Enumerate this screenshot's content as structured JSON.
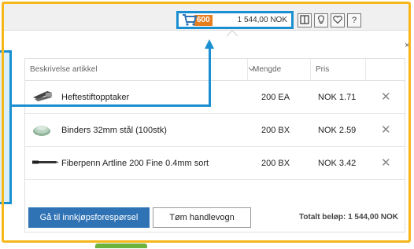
{
  "toolbar": {
    "cart_count": "600",
    "cart_total": "1 544,00 NOK",
    "buttons": [
      "layout-icon",
      "lightbulb-icon",
      "heart-icon",
      "help-icon"
    ],
    "help_label": "?"
  },
  "table": {
    "headers": {
      "description": "Beskrivelse artikkel",
      "quantity": "Mengde",
      "price": "Pris"
    },
    "rows": [
      {
        "description": "Heftestiftopptaker",
        "quantity": "200 EA",
        "price": "NOK 1.71",
        "icon": "staple-remover-icon"
      },
      {
        "description": "Binders 32mm stål (100stk)",
        "quantity": "200 BX",
        "price": "NOK 2.59",
        "icon": "paper-clips-icon"
      },
      {
        "description": "Fiberpenn Artline 200 Fine 0.4mm sort",
        "quantity": "200 BX",
        "price": "NOK 3.42",
        "icon": "pen-icon"
      }
    ],
    "delete_glyph": "✕"
  },
  "footer": {
    "primary_button": "Gå til innkjøpsforespørsel",
    "secondary_button": "Tøm handlevogn",
    "total_label": "Totalt beløp: 1 544,00 NOK"
  },
  "close_glyph": "×",
  "colors": {
    "highlight_frame": "#f5b719",
    "callout_blue": "#1a8fd1",
    "cart_badge": "#e87d1e",
    "primary_button": "#2f73b5"
  }
}
